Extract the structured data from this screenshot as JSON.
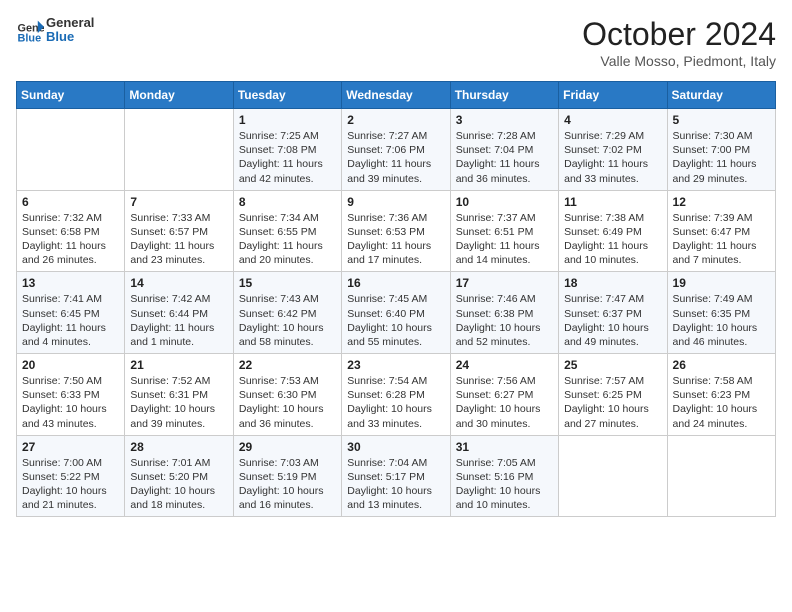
{
  "header": {
    "logo_general": "General",
    "logo_blue": "Blue",
    "month_title": "October 2024",
    "location": "Valle Mosso, Piedmont, Italy"
  },
  "days_of_week": [
    "Sunday",
    "Monday",
    "Tuesday",
    "Wednesday",
    "Thursday",
    "Friday",
    "Saturday"
  ],
  "weeks": [
    [
      {
        "day": "",
        "sunrise": "",
        "sunset": "",
        "daylight": ""
      },
      {
        "day": "",
        "sunrise": "",
        "sunset": "",
        "daylight": ""
      },
      {
        "day": "1",
        "sunrise": "Sunrise: 7:25 AM",
        "sunset": "Sunset: 7:08 PM",
        "daylight": "Daylight: 11 hours and 42 minutes."
      },
      {
        "day": "2",
        "sunrise": "Sunrise: 7:27 AM",
        "sunset": "Sunset: 7:06 PM",
        "daylight": "Daylight: 11 hours and 39 minutes."
      },
      {
        "day": "3",
        "sunrise": "Sunrise: 7:28 AM",
        "sunset": "Sunset: 7:04 PM",
        "daylight": "Daylight: 11 hours and 36 minutes."
      },
      {
        "day": "4",
        "sunrise": "Sunrise: 7:29 AM",
        "sunset": "Sunset: 7:02 PM",
        "daylight": "Daylight: 11 hours and 33 minutes."
      },
      {
        "day": "5",
        "sunrise": "Sunrise: 7:30 AM",
        "sunset": "Sunset: 7:00 PM",
        "daylight": "Daylight: 11 hours and 29 minutes."
      }
    ],
    [
      {
        "day": "6",
        "sunrise": "Sunrise: 7:32 AM",
        "sunset": "Sunset: 6:58 PM",
        "daylight": "Daylight: 11 hours and 26 minutes."
      },
      {
        "day": "7",
        "sunrise": "Sunrise: 7:33 AM",
        "sunset": "Sunset: 6:57 PM",
        "daylight": "Daylight: 11 hours and 23 minutes."
      },
      {
        "day": "8",
        "sunrise": "Sunrise: 7:34 AM",
        "sunset": "Sunset: 6:55 PM",
        "daylight": "Daylight: 11 hours and 20 minutes."
      },
      {
        "day": "9",
        "sunrise": "Sunrise: 7:36 AM",
        "sunset": "Sunset: 6:53 PM",
        "daylight": "Daylight: 11 hours and 17 minutes."
      },
      {
        "day": "10",
        "sunrise": "Sunrise: 7:37 AM",
        "sunset": "Sunset: 6:51 PM",
        "daylight": "Daylight: 11 hours and 14 minutes."
      },
      {
        "day": "11",
        "sunrise": "Sunrise: 7:38 AM",
        "sunset": "Sunset: 6:49 PM",
        "daylight": "Daylight: 11 hours and 10 minutes."
      },
      {
        "day": "12",
        "sunrise": "Sunrise: 7:39 AM",
        "sunset": "Sunset: 6:47 PM",
        "daylight": "Daylight: 11 hours and 7 minutes."
      }
    ],
    [
      {
        "day": "13",
        "sunrise": "Sunrise: 7:41 AM",
        "sunset": "Sunset: 6:45 PM",
        "daylight": "Daylight: 11 hours and 4 minutes."
      },
      {
        "day": "14",
        "sunrise": "Sunrise: 7:42 AM",
        "sunset": "Sunset: 6:44 PM",
        "daylight": "Daylight: 11 hours and 1 minute."
      },
      {
        "day": "15",
        "sunrise": "Sunrise: 7:43 AM",
        "sunset": "Sunset: 6:42 PM",
        "daylight": "Daylight: 10 hours and 58 minutes."
      },
      {
        "day": "16",
        "sunrise": "Sunrise: 7:45 AM",
        "sunset": "Sunset: 6:40 PM",
        "daylight": "Daylight: 10 hours and 55 minutes."
      },
      {
        "day": "17",
        "sunrise": "Sunrise: 7:46 AM",
        "sunset": "Sunset: 6:38 PM",
        "daylight": "Daylight: 10 hours and 52 minutes."
      },
      {
        "day": "18",
        "sunrise": "Sunrise: 7:47 AM",
        "sunset": "Sunset: 6:37 PM",
        "daylight": "Daylight: 10 hours and 49 minutes."
      },
      {
        "day": "19",
        "sunrise": "Sunrise: 7:49 AM",
        "sunset": "Sunset: 6:35 PM",
        "daylight": "Daylight: 10 hours and 46 minutes."
      }
    ],
    [
      {
        "day": "20",
        "sunrise": "Sunrise: 7:50 AM",
        "sunset": "Sunset: 6:33 PM",
        "daylight": "Daylight: 10 hours and 43 minutes."
      },
      {
        "day": "21",
        "sunrise": "Sunrise: 7:52 AM",
        "sunset": "Sunset: 6:31 PM",
        "daylight": "Daylight: 10 hours and 39 minutes."
      },
      {
        "day": "22",
        "sunrise": "Sunrise: 7:53 AM",
        "sunset": "Sunset: 6:30 PM",
        "daylight": "Daylight: 10 hours and 36 minutes."
      },
      {
        "day": "23",
        "sunrise": "Sunrise: 7:54 AM",
        "sunset": "Sunset: 6:28 PM",
        "daylight": "Daylight: 10 hours and 33 minutes."
      },
      {
        "day": "24",
        "sunrise": "Sunrise: 7:56 AM",
        "sunset": "Sunset: 6:27 PM",
        "daylight": "Daylight: 10 hours and 30 minutes."
      },
      {
        "day": "25",
        "sunrise": "Sunrise: 7:57 AM",
        "sunset": "Sunset: 6:25 PM",
        "daylight": "Daylight: 10 hours and 27 minutes."
      },
      {
        "day": "26",
        "sunrise": "Sunrise: 7:58 AM",
        "sunset": "Sunset: 6:23 PM",
        "daylight": "Daylight: 10 hours and 24 minutes."
      }
    ],
    [
      {
        "day": "27",
        "sunrise": "Sunrise: 7:00 AM",
        "sunset": "Sunset: 5:22 PM",
        "daylight": "Daylight: 10 hours and 21 minutes."
      },
      {
        "day": "28",
        "sunrise": "Sunrise: 7:01 AM",
        "sunset": "Sunset: 5:20 PM",
        "daylight": "Daylight: 10 hours and 18 minutes."
      },
      {
        "day": "29",
        "sunrise": "Sunrise: 7:03 AM",
        "sunset": "Sunset: 5:19 PM",
        "daylight": "Daylight: 10 hours and 16 minutes."
      },
      {
        "day": "30",
        "sunrise": "Sunrise: 7:04 AM",
        "sunset": "Sunset: 5:17 PM",
        "daylight": "Daylight: 10 hours and 13 minutes."
      },
      {
        "day": "31",
        "sunrise": "Sunrise: 7:05 AM",
        "sunset": "Sunset: 5:16 PM",
        "daylight": "Daylight: 10 hours and 10 minutes."
      },
      {
        "day": "",
        "sunrise": "",
        "sunset": "",
        "daylight": ""
      },
      {
        "day": "",
        "sunrise": "",
        "sunset": "",
        "daylight": ""
      }
    ]
  ]
}
